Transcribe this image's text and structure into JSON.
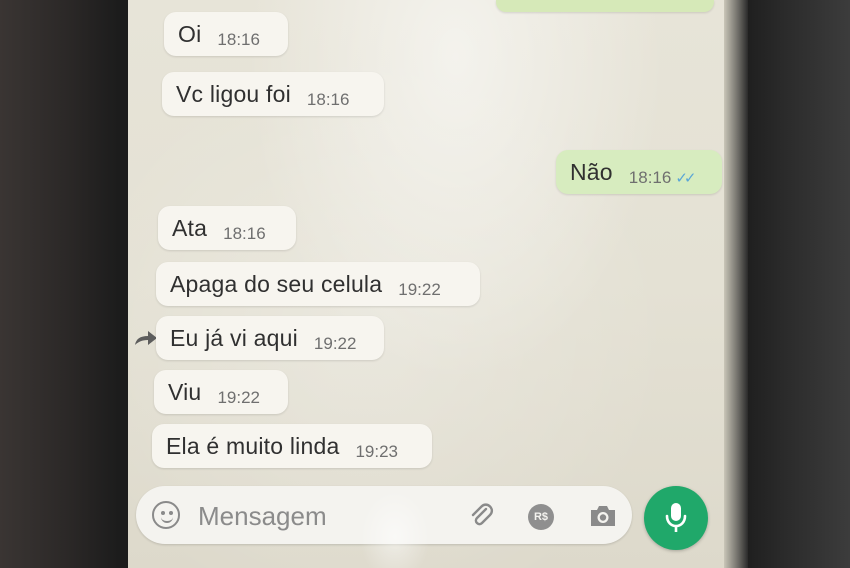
{
  "chat": {
    "messages": [
      {
        "text": "Oi",
        "time": "18:16",
        "direction": "incoming"
      },
      {
        "text": "Vc ligou foi",
        "time": "18:16",
        "direction": "incoming"
      },
      {
        "text": "Não",
        "time": "18:16",
        "direction": "outgoing",
        "status": "read-double-check-icon"
      },
      {
        "text": "Ata",
        "time": "18:16",
        "direction": "incoming"
      },
      {
        "text": "Apaga do seu celula",
        "time": "19:22",
        "direction": "incoming"
      },
      {
        "text": "Eu já vi aqui",
        "time": "19:22",
        "direction": "incoming",
        "forward_icon": "forward-icon"
      },
      {
        "text": "Viu",
        "time": "19:22",
        "direction": "incoming"
      },
      {
        "text": "Ela é muito linda",
        "time": "19:23",
        "direction": "incoming"
      }
    ]
  },
  "composer": {
    "placeholder": "Mensagem",
    "payment_label": "R$",
    "icons": [
      "emoji-icon",
      "attach-icon",
      "payment-icon",
      "camera-icon",
      "microphone-icon"
    ]
  },
  "colors": {
    "incoming_bubble": "#f7f5ef",
    "outgoing_bubble": "#d7ecbf",
    "mic_button": "#20a86a",
    "read_ticks": "#5aa6d6"
  }
}
